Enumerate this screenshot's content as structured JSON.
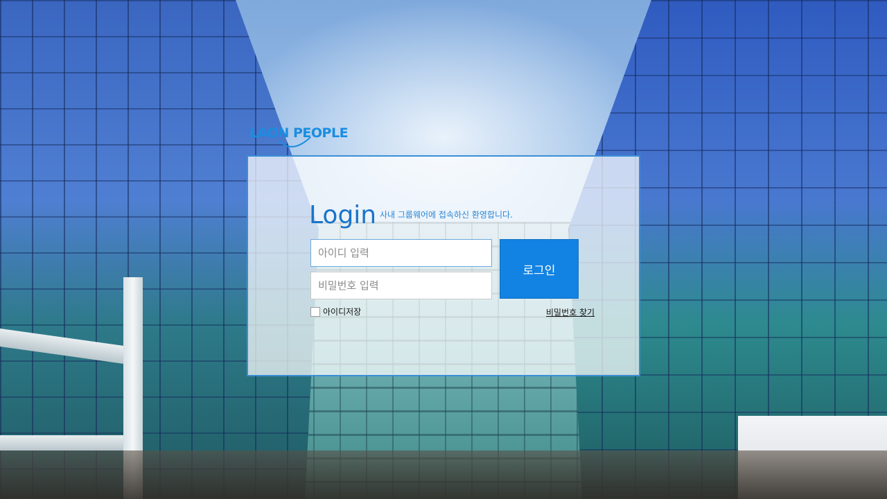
{
  "logo": {
    "text": "LAON PEOPLE",
    "color": "#1a8de0"
  },
  "login": {
    "title": "Login",
    "subtitle": "사내 그룹웨어에 접속하신 환영합니다.",
    "id_placeholder": "아이디 입력",
    "pw_placeholder": "비밀번호 입력",
    "login_button": "로그인",
    "remember_label": "아이디저장",
    "find_link": "비밀번호 찾기"
  },
  "colors": {
    "accent": "#1283e3",
    "panel_border": "#3a8fd6",
    "title": "#1a74c9"
  },
  "icons": {
    "remember": "checkbox-unchecked-icon"
  }
}
